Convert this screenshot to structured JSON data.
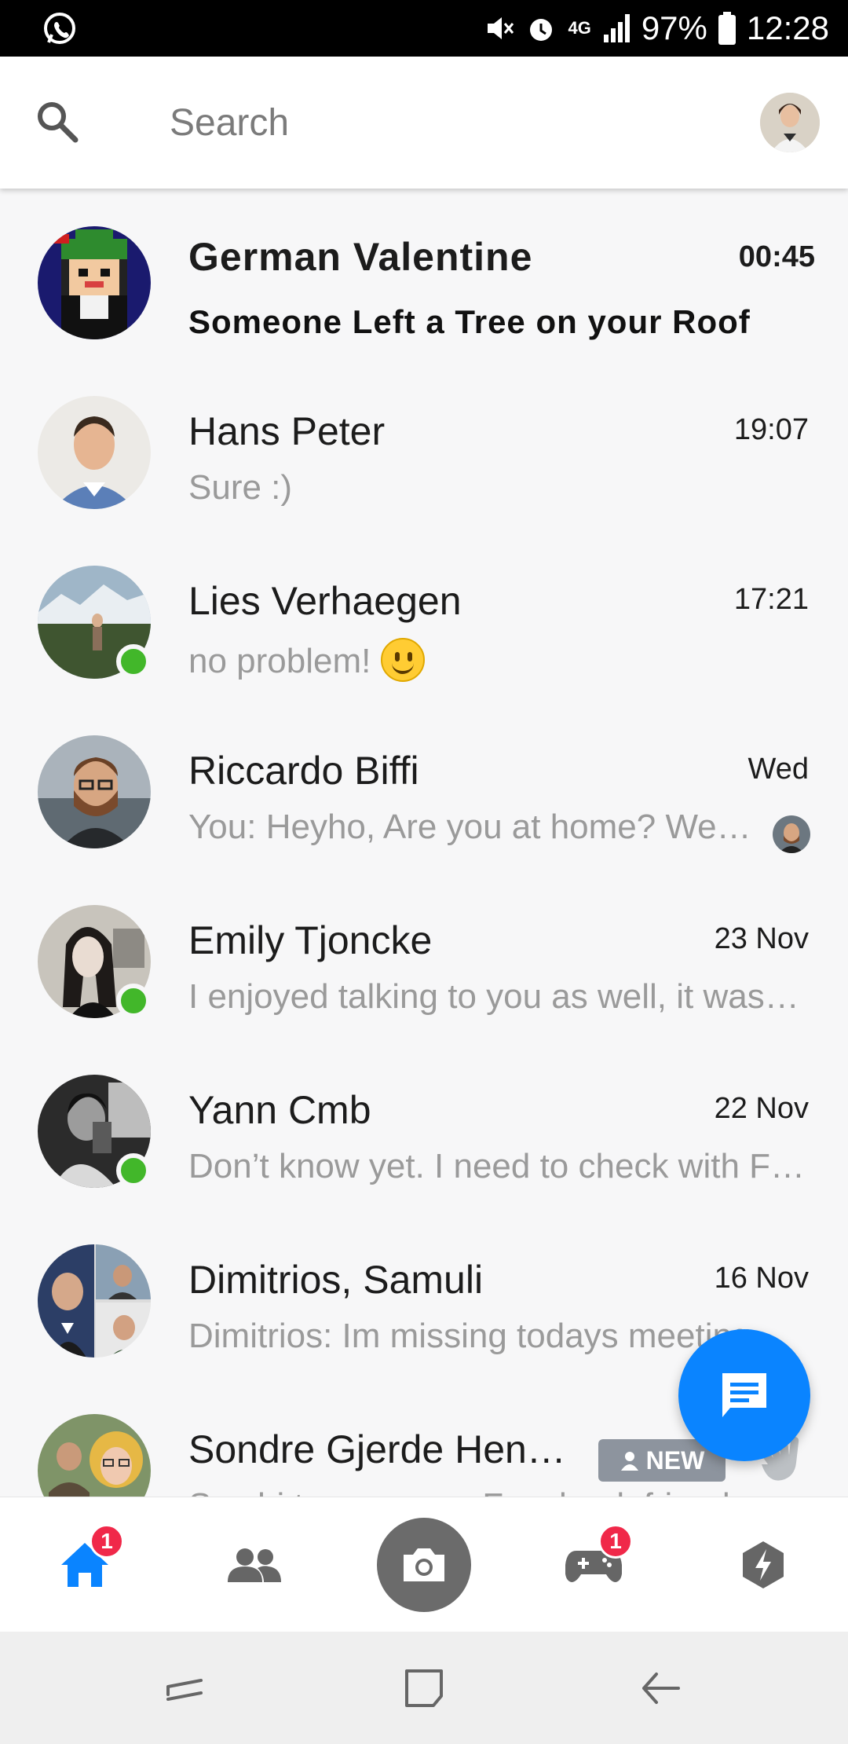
{
  "status_bar": {
    "battery": "97%",
    "time": "12:28",
    "network": "4G"
  },
  "search": {
    "placeholder": "Search"
  },
  "chats": [
    {
      "name": "German Valentine",
      "time": "00:45",
      "preview": "Someone Left a Tree on your Roof",
      "unread": true,
      "online": false
    },
    {
      "name": "Hans Peter",
      "time": "19:07",
      "preview": "Sure :)",
      "unread": false,
      "online": false
    },
    {
      "name": "Lies Verhaegen",
      "time": "17:21",
      "preview": "no problem!",
      "unread": false,
      "online": true
    },
    {
      "name": "Riccardo Biffi",
      "time": "Wed",
      "preview": "You: Heyho, Are you at home? We…",
      "unread": false,
      "online": false
    },
    {
      "name": "Emily Tjoncke",
      "time": "23 Nov",
      "preview": "I enjoyed talking to you as well, it was…",
      "unread": false,
      "online": true
    },
    {
      "name": "Yann Cmb",
      "time": "22 Nov",
      "preview": "Don’t know yet. I need to check with F…",
      "unread": false,
      "online": true
    },
    {
      "name": "Dimitrios, Samuli",
      "time": "16 Nov",
      "preview": "Dimitrios: Im missing todays meeting…",
      "unread": false,
      "online": false
    },
    {
      "name": "Sondre Gjerde Hen…",
      "time": "",
      "preview": "Say hi to your new Facebook friend",
      "unread": false,
      "online": false,
      "badge": "NEW"
    }
  ],
  "bottom_nav": {
    "home_badge": "1",
    "games_badge": "1"
  },
  "colors": {
    "accent": "#0a84ff",
    "online": "#42b72a",
    "badge": "#f02849"
  }
}
